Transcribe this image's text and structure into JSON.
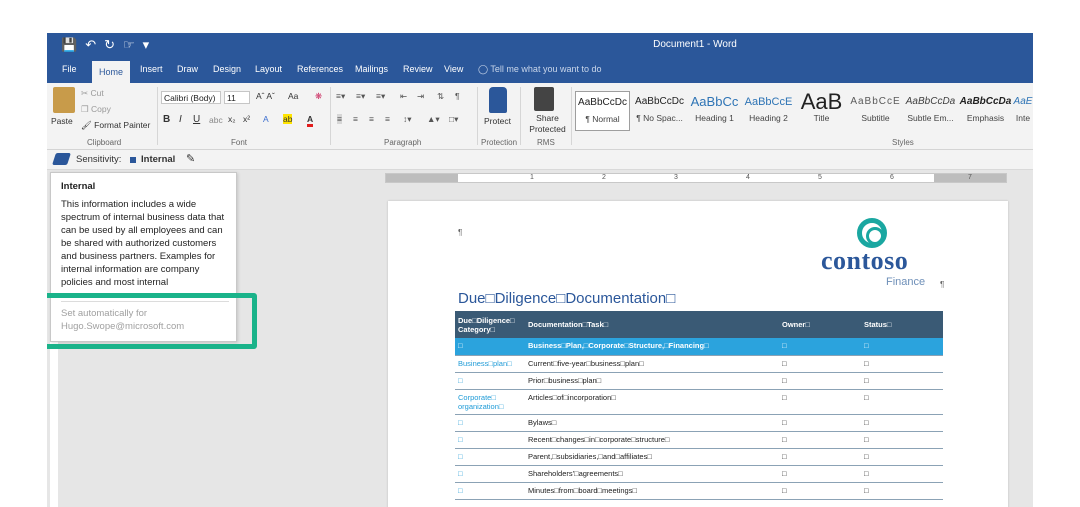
{
  "window": {
    "title": "Document1 - Word"
  },
  "tabs": [
    "File",
    "Home",
    "Insert",
    "Draw",
    "Design",
    "Layout",
    "References",
    "Mailings",
    "Review",
    "View"
  ],
  "tell_me": "Tell me what you want to do",
  "clipboard": {
    "paste": "Paste",
    "cut": "Cut",
    "copy": "Copy",
    "format_painter": "Format Painter",
    "group": "Clipboard"
  },
  "font": {
    "name": "Calibri (Body)",
    "size": "11",
    "case_label": "Aa",
    "group": "Font"
  },
  "paragraph": {
    "group": "Paragraph"
  },
  "protection": {
    "protect": "Protect",
    "group": "Protection"
  },
  "rms": {
    "share_protected": "Share Protected",
    "group": "RMS"
  },
  "styles": {
    "group": "Styles",
    "items": [
      {
        "preview": "AaBbCcDc",
        "name": "¶ Normal"
      },
      {
        "preview": "AaBbCcDc",
        "name": "¶ No Spac..."
      },
      {
        "preview": "AaBbCc",
        "name": "Heading 1"
      },
      {
        "preview": "AaBbCcE",
        "name": "Heading 2"
      },
      {
        "preview": "AaB",
        "name": "Title"
      },
      {
        "preview": "AaBbCcE",
        "name": "Subtitle"
      },
      {
        "preview": "AaBbCcDa",
        "name": "Subtle Em..."
      },
      {
        "preview": "AaBbCcDa",
        "name": "Emphasis"
      },
      {
        "preview": "AaE",
        "name": "Inte"
      }
    ]
  },
  "sensitivity": {
    "label": "Sensitivity:",
    "value": "Internal"
  },
  "tooltip": {
    "title": "Internal",
    "body": "This information includes a wide spectrum of internal business data that can be shared with authorized customers and business partners. Examples for internal information are company policies and most internal",
    "body_shown": "This information includes a wide spectrum of internal business data that can be used by all employees and can be shared with authorized customers and business partners. Examples for internal information are company policies and most internal",
    "set_auto": "Set automatically for Hugo.Swope@microsoft.com"
  },
  "ruler": {
    "marks": [
      "1",
      "2",
      "3",
      "4",
      "5",
      "6",
      "7"
    ]
  },
  "document": {
    "logo_name": "contoso",
    "logo_sub": "Finance",
    "heading": "Due□Diligence□Documentation□",
    "columns": [
      "Due□Diligence□ Category□",
      "Documentation□Task□",
      "Owner□",
      "Status□"
    ],
    "rows": [
      {
        "cat": "□",
        "task": "Business□Plan,□Corporate□Structure,□Financing□",
        "owner": "□",
        "status": "□"
      },
      {
        "cat": "Business□plan□",
        "task": "Current□five-year□business□plan□",
        "owner": "□",
        "status": "□"
      },
      {
        "cat": "□",
        "task": "Prior□business□plan□",
        "owner": "□",
        "status": "□"
      },
      {
        "cat": "Corporate□ organization□",
        "task": "Articles□of□incorporation□",
        "owner": "□",
        "status": "□"
      },
      {
        "cat": "□",
        "task": "Bylaws□",
        "owner": "□",
        "status": "□"
      },
      {
        "cat": "□",
        "task": "Recent□changes□in□corporate□structure□",
        "owner": "□",
        "status": "□"
      },
      {
        "cat": "□",
        "task": "Parent,□subsidiaries,□and□affiliates□",
        "owner": "□",
        "status": "□"
      },
      {
        "cat": "□",
        "task": "Shareholders'□agreements□",
        "owner": "□",
        "status": "□"
      },
      {
        "cat": "□",
        "task": "Minutes□from□board□meetings□",
        "owner": "□",
        "status": "□"
      }
    ]
  },
  "colors": {
    "word_blue": "#2b579a",
    "table_header": "#3a5a75",
    "highlight_row": "#2ba3dd",
    "callout": "#1ab38a",
    "brand_teal": "#1aa7a1"
  }
}
